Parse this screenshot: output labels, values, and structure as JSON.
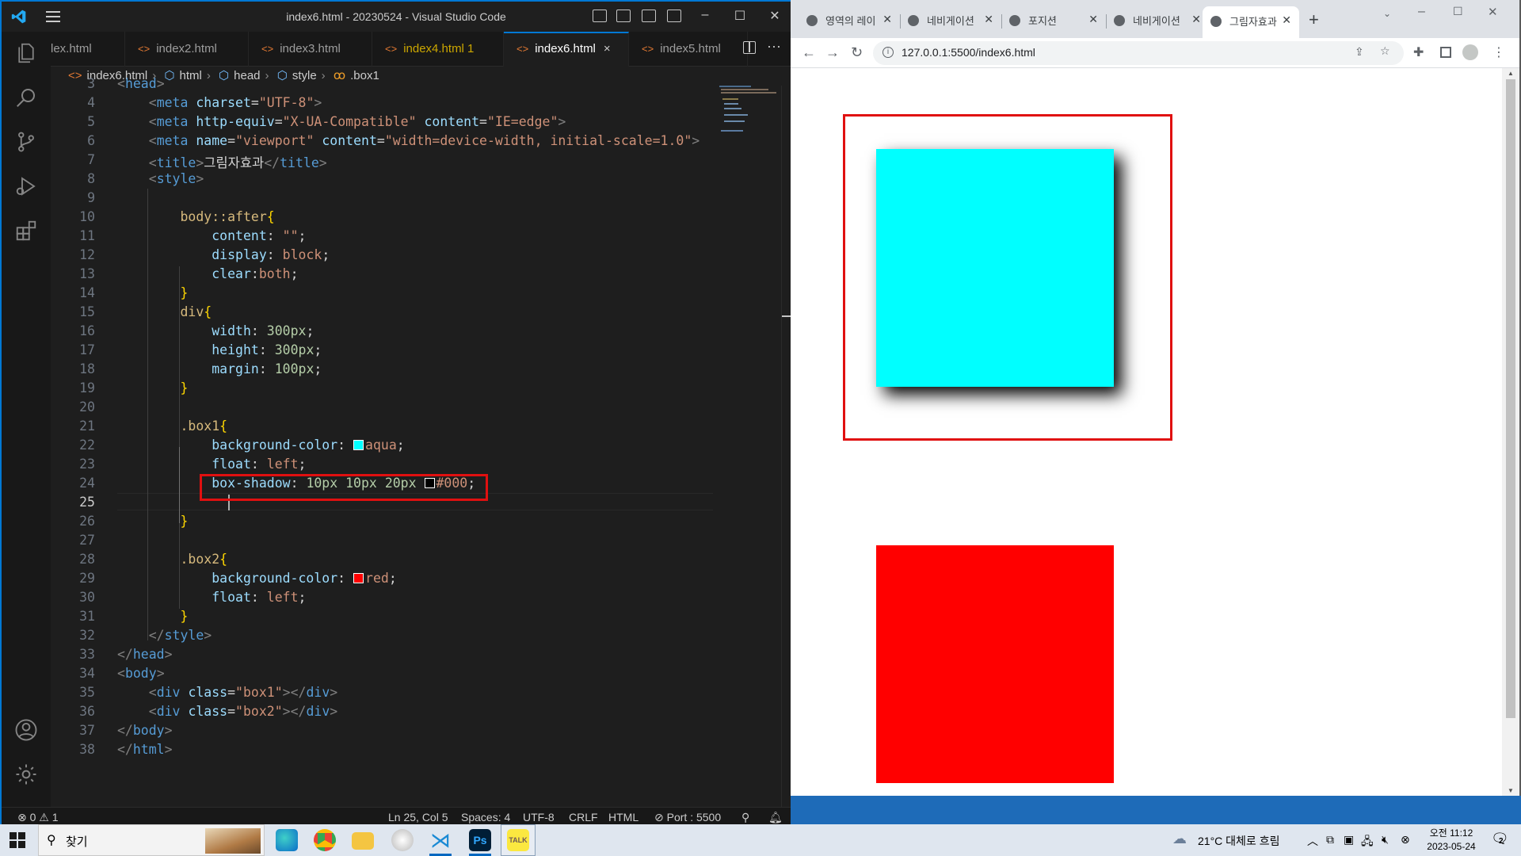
{
  "vscode": {
    "window_title": "index6.html - 20230524 - Visual Studio Code",
    "tabs": [
      {
        "label": "lex.html",
        "state": "normal"
      },
      {
        "label": "index2.html",
        "state": "normal"
      },
      {
        "label": "index3.html",
        "state": "normal"
      },
      {
        "label": "index4.html 1",
        "state": "warning"
      },
      {
        "label": "index6.html",
        "state": "active"
      },
      {
        "label": "index5.html",
        "state": "normal"
      }
    ],
    "tab_close_glyph": "×",
    "breadcrumb": [
      "index6.html",
      "html",
      "head",
      "style",
      ".box1"
    ],
    "line_numbers": [
      "3",
      "4",
      "5",
      "6",
      "7",
      "8",
      "9",
      "10",
      "11",
      "12",
      "13",
      "14",
      "15",
      "16",
      "17",
      "18",
      "19",
      "20",
      "21",
      "22",
      "23",
      "24",
      "25",
      "26",
      "27",
      "28",
      "29",
      "30",
      "31",
      "32",
      "33",
      "34",
      "35",
      "36",
      "37",
      "38"
    ],
    "current_line": "25",
    "code": {
      "l3": "<head>",
      "l4": {
        "tag": "meta",
        "attr": "charset",
        "val": "\"UTF-8\""
      },
      "l5": {
        "tag": "meta",
        "attr1": "http-equiv",
        "val1": "\"X-UA-Compatible\"",
        "attr2": "content",
        "val2": "\"IE=edge\""
      },
      "l6": {
        "tag": "meta",
        "attr1": "name",
        "val1": "\"viewport\"",
        "attr2": "content",
        "val2": "\"width=device-width, initial-scale=1.0\""
      },
      "l7": {
        "tag": "title",
        "text": "그림자효과"
      },
      "l8": {
        "tag": "style"
      },
      "l10": "body::after",
      "l11": {
        "prop": "content",
        "val": "\"\""
      },
      "l12": {
        "prop": "display",
        "val": "block"
      },
      "l13": {
        "prop": "clear",
        "val": "both"
      },
      "l15": "div",
      "l16": {
        "prop": "width",
        "val": "300px"
      },
      "l17": {
        "prop": "height",
        "val": "300px"
      },
      "l18": {
        "prop": "margin",
        "val": "100px"
      },
      "l21": ".box1",
      "l22": {
        "prop": "background-color",
        "val": "aqua",
        "swatch": "#00ffff"
      },
      "l23": {
        "prop": "float",
        "val": "left"
      },
      "l24": {
        "prop": "box-shadow",
        "v1": "10px",
        "v2": "10px",
        "v3": "20px",
        "val": "#000",
        "swatch": "#000000"
      },
      "l28": ".box2",
      "l29": {
        "prop": "background-color",
        "val": "red",
        "swatch": "#ff0000"
      },
      "l30": {
        "prop": "float",
        "val": "left"
      },
      "l32": {
        "tag": "style"
      },
      "l33": {
        "tag": "head"
      },
      "l34": {
        "tag": "body"
      },
      "l35": {
        "tag": "div",
        "attr": "class",
        "val": "\"box1\""
      },
      "l36": {
        "tag": "div",
        "attr": "class",
        "val": "\"box2\""
      },
      "l37": {
        "tag": "body"
      },
      "l38": {
        "tag": "html"
      }
    },
    "status": {
      "errors": "0",
      "warnings": "1",
      "position": "Ln 25, Col 5",
      "spaces": "Spaces: 4",
      "encoding": "UTF-8",
      "eol": "CRLF",
      "language": "HTML",
      "port": "Port : 5500"
    },
    "highlight_color": "#e01010"
  },
  "browser": {
    "tabs": [
      {
        "label": "영역의 레이",
        "active": false
      },
      {
        "label": "네비게이션",
        "active": false
      },
      {
        "label": "포지션",
        "active": false
      },
      {
        "label": "네비게이션",
        "active": false
      },
      {
        "label": "그림자효과",
        "active": true
      }
    ],
    "new_tab": "+",
    "url": "127.0.0.1:5500/index6.html",
    "content": {
      "box1_color": "#00ffff",
      "box2_color": "#ff0000",
      "annotation_color": "#e01010"
    }
  },
  "taskbar": {
    "search_placeholder": "찾기",
    "weather": "21°C 대체로 흐림",
    "time": "오전 11:12",
    "date": "2023-05-24",
    "notification_count": "2"
  }
}
